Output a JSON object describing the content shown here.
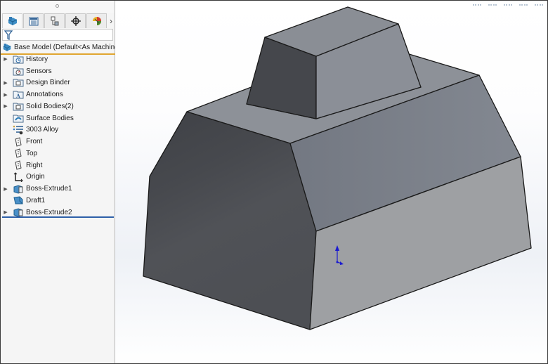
{
  "panel": {
    "tabs": [
      {
        "name": "feature-manager",
        "icon": "part-icon",
        "active": true
      },
      {
        "name": "property-manager",
        "icon": "property-list-icon",
        "active": false
      },
      {
        "name": "configuration-manager",
        "icon": "configuration-icon",
        "active": false
      },
      {
        "name": "dimxpert-manager",
        "icon": "crosshair-icon",
        "active": false
      },
      {
        "name": "display-manager",
        "icon": "appearance-ball-icon",
        "active": false
      }
    ],
    "more_tabs": "›",
    "filter": {
      "icon": "funnel-icon",
      "value": ""
    },
    "root": {
      "label": "Base Model  (Default<As Machined>",
      "icon": "part-icon"
    },
    "tree": [
      {
        "label": "History",
        "icon": "history-folder-icon",
        "expandable": true
      },
      {
        "label": "Sensors",
        "icon": "sensors-folder-icon",
        "expandable": false
      },
      {
        "label": "Design Binder",
        "icon": "design-binder-folder-icon",
        "expandable": true
      },
      {
        "label": "Annotations",
        "icon": "annotations-folder-icon",
        "expandable": true
      },
      {
        "label": "Solid Bodies(2)",
        "icon": "solid-bodies-folder-icon",
        "expandable": true
      },
      {
        "label": "Surface Bodies",
        "icon": "surface-bodies-folder-icon",
        "expandable": false
      },
      {
        "label": "3003 Alloy",
        "icon": "material-icon",
        "expandable": false
      },
      {
        "label": "Front",
        "icon": "plane-icon",
        "expandable": false
      },
      {
        "label": "Top",
        "icon": "plane-icon",
        "expandable": false
      },
      {
        "label": "Right",
        "icon": "plane-icon",
        "expandable": false
      },
      {
        "label": "Origin",
        "icon": "origin-icon",
        "expandable": false
      },
      {
        "label": "Boss-Extrude1",
        "icon": "extrude-feature-icon",
        "expandable": true
      },
      {
        "label": "Draft1",
        "icon": "draft-feature-icon",
        "expandable": false
      },
      {
        "label": "Boss-Extrude2",
        "icon": "extrude-feature-icon",
        "expandable": true
      }
    ]
  },
  "viewport": {
    "model": "Base Model",
    "colors": {
      "edge": "#1a1a1a",
      "top_block_top": "#8a8e95",
      "top_block_left": "#45474c",
      "top_block_front": "#8b8f97",
      "body_top": "#8d9198",
      "body_left": "#4d4f54",
      "body_upper_right": "#7b8089",
      "body_lower_right": "#9ea0a3",
      "triad": "#1a1ad0"
    }
  }
}
